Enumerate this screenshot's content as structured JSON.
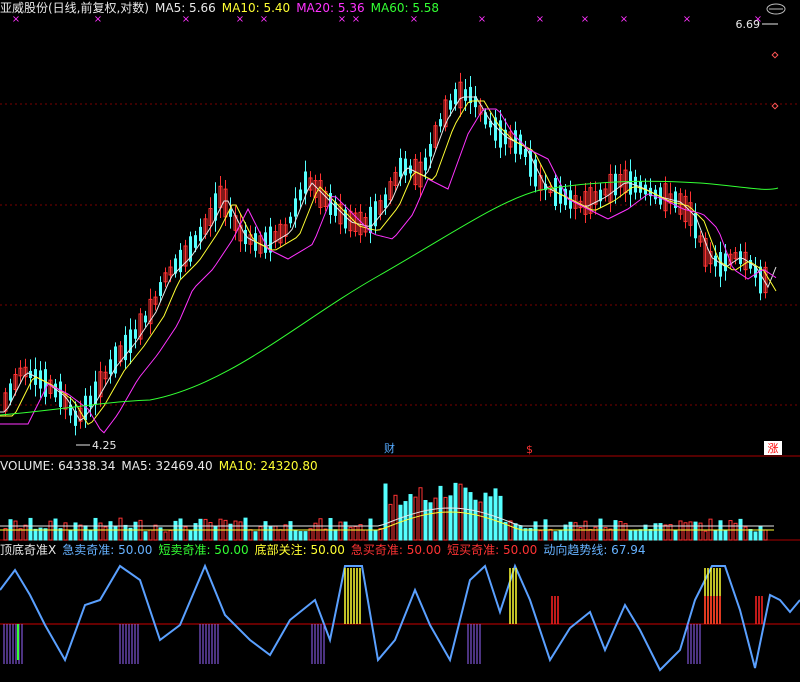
{
  "price_panel": {
    "title": "亚威股份(日线,前复权,对数)",
    "ma5": "MA5: 5.66",
    "ma10": "MA10: 5.40",
    "ma20": "MA20: 5.36",
    "ma60": "MA60: 5.58",
    "high_label": "6.69",
    "low_label": "4.25",
    "marker_cai": "财",
    "marker_dollar": "$",
    "marker_zhang": "涨"
  },
  "volume_panel": {
    "volume": "VOLUME: 64338.34",
    "ma5": "MA5: 32469.40",
    "ma10": "MA10: 24320.80"
  },
  "indicator_panel": {
    "name": "顶底奇准X",
    "jmq": "急卖奇准: 50.00",
    "dmq": "短卖奇准: 50.00",
    "dbgz": "底部关注: 50.00",
    "jmqb": "急买奇准: 50.00",
    "dmqb": "短买奇准: 50.00",
    "dxqs": "动向趋势线: 67.94"
  },
  "colors": {
    "up": "#ff3333",
    "down": "#55ffff",
    "ma5": "#e8e8e8",
    "ma10": "#ffff33",
    "ma20": "#ff33ff",
    "ma60": "#33ff33",
    "trend": "#5aa0ff"
  }
}
